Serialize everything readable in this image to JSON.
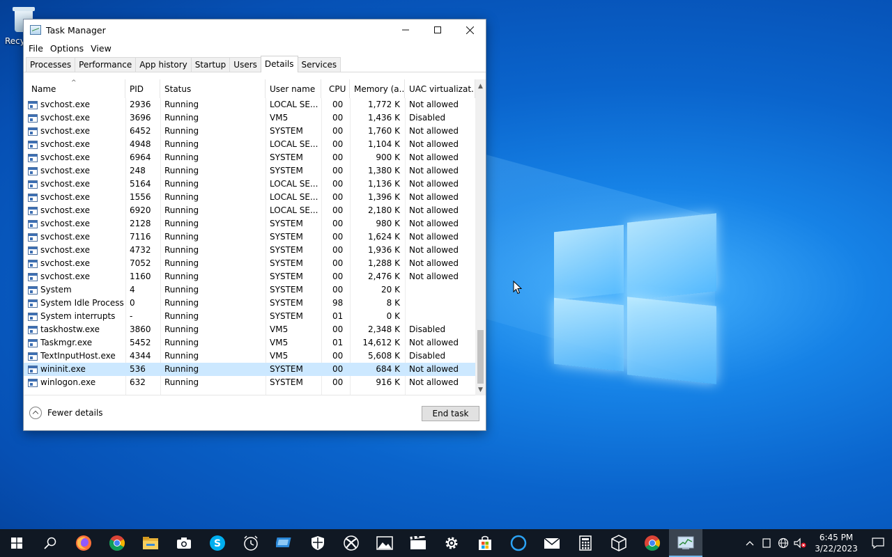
{
  "desktop": {
    "icon_label": "Recy"
  },
  "window": {
    "title": "Task Manager",
    "controls": {
      "minimize": "—",
      "maximize": "☐",
      "close": "✕"
    }
  },
  "menu": [
    "File",
    "Options",
    "View"
  ],
  "tabs": [
    {
      "label": "Processes"
    },
    {
      "label": "Performance"
    },
    {
      "label": "App history"
    },
    {
      "label": "Startup"
    },
    {
      "label": "Users"
    },
    {
      "label": "Details",
      "active": true
    },
    {
      "label": "Services"
    }
  ],
  "columns": [
    "Name",
    "PID",
    "Status",
    "User name",
    "CPU",
    "Memory (a...",
    "UAC virtualizat..."
  ],
  "rows": [
    [
      "svchost.exe",
      "2936",
      "Running",
      "LOCAL SE...",
      "00",
      "1,772 K",
      "Not allowed"
    ],
    [
      "svchost.exe",
      "3696",
      "Running",
      "VM5",
      "00",
      "1,436 K",
      "Disabled"
    ],
    [
      "svchost.exe",
      "6452",
      "Running",
      "SYSTEM",
      "00",
      "1,760 K",
      "Not allowed"
    ],
    [
      "svchost.exe",
      "4948",
      "Running",
      "LOCAL SE...",
      "00",
      "1,104 K",
      "Not allowed"
    ],
    [
      "svchost.exe",
      "6964",
      "Running",
      "SYSTEM",
      "00",
      "900 K",
      "Not allowed"
    ],
    [
      "svchost.exe",
      "248",
      "Running",
      "SYSTEM",
      "00",
      "1,380 K",
      "Not allowed"
    ],
    [
      "svchost.exe",
      "5164",
      "Running",
      "LOCAL SE...",
      "00",
      "1,136 K",
      "Not allowed"
    ],
    [
      "svchost.exe",
      "1556",
      "Running",
      "LOCAL SE...",
      "00",
      "1,396 K",
      "Not allowed"
    ],
    [
      "svchost.exe",
      "6920",
      "Running",
      "LOCAL SE...",
      "00",
      "2,180 K",
      "Not allowed"
    ],
    [
      "svchost.exe",
      "2128",
      "Running",
      "SYSTEM",
      "00",
      "980 K",
      "Not allowed"
    ],
    [
      "svchost.exe",
      "7116",
      "Running",
      "SYSTEM",
      "00",
      "1,624 K",
      "Not allowed"
    ],
    [
      "svchost.exe",
      "4732",
      "Running",
      "SYSTEM",
      "00",
      "1,936 K",
      "Not allowed"
    ],
    [
      "svchost.exe",
      "7052",
      "Running",
      "SYSTEM",
      "00",
      "1,288 K",
      "Not allowed"
    ],
    [
      "svchost.exe",
      "1160",
      "Running",
      "SYSTEM",
      "00",
      "2,476 K",
      "Not allowed"
    ],
    [
      "System",
      "4",
      "Running",
      "SYSTEM",
      "00",
      "20 K",
      ""
    ],
    [
      "System Idle Process",
      "0",
      "Running",
      "SYSTEM",
      "98",
      "8 K",
      ""
    ],
    [
      "System interrupts",
      "-",
      "Running",
      "SYSTEM",
      "01",
      "0 K",
      ""
    ],
    [
      "taskhostw.exe",
      "3860",
      "Running",
      "VM5",
      "00",
      "2,348 K",
      "Disabled"
    ],
    [
      "Taskmgr.exe",
      "5452",
      "Running",
      "VM5",
      "01",
      "14,612 K",
      "Not allowed"
    ],
    [
      "TextInputHost.exe",
      "4344",
      "Running",
      "VM5",
      "00",
      "5,608 K",
      "Disabled"
    ],
    [
      "wininit.exe",
      "536",
      "Running",
      "SYSTEM",
      "00",
      "684 K",
      "Not allowed"
    ],
    [
      "winlogon.exe",
      "632",
      "Running",
      "SYSTEM",
      "00",
      "916 K",
      "Not allowed"
    ]
  ],
  "selected_row": 20,
  "footer": {
    "fewer_details": "Fewer details",
    "end_task": "End task"
  },
  "taskbar": {
    "apps": [
      "start-icon",
      "search-icon",
      "firefox-icon",
      "chrome-icon",
      "file-explorer-icon",
      "camera-icon",
      "skype-icon",
      "alarms-clock-icon",
      "remote-desktop-icon",
      "windows-security-icon",
      "xbox-icon",
      "photos-icon",
      "movies-tv-icon",
      "settings-icon",
      "store-icon",
      "cortana-icon",
      "mail-icon",
      "calculator-icon",
      "3d-viewer-icon",
      "chrome-canary-icon",
      "task-manager-icon"
    ],
    "clock_time": "6:45 PM",
    "clock_date": "3/22/2023"
  }
}
